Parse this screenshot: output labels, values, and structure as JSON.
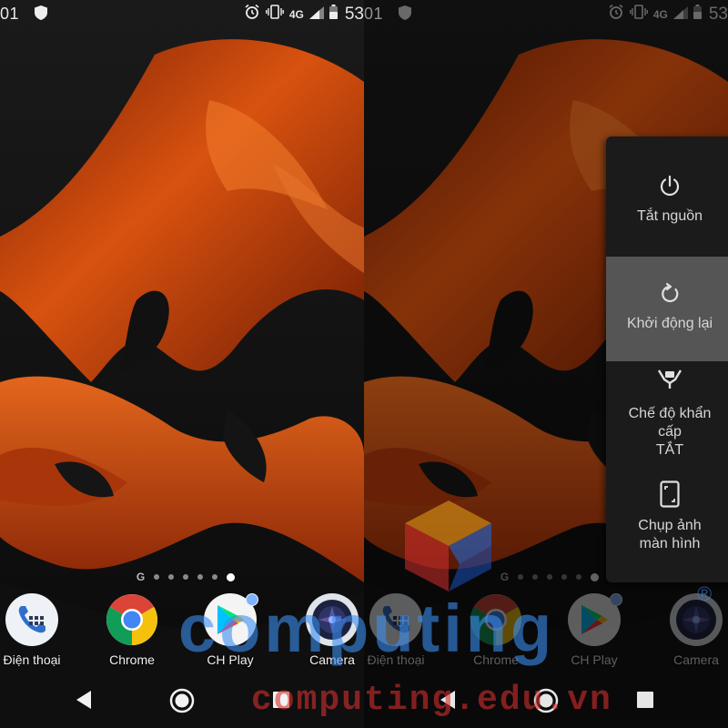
{
  "status_bar": {
    "time": "01",
    "network": "4G",
    "battery": "53"
  },
  "dock": [
    {
      "label": "Điện thoại"
    },
    {
      "label": "Chrome"
    },
    {
      "label": "CH Play"
    },
    {
      "label": "Camera"
    }
  ],
  "page_indicator": {
    "launcher_letter": "G",
    "pages": 6,
    "active_page": 6
  },
  "power_menu": {
    "items": [
      {
        "label": "Tắt nguồn"
      },
      {
        "label": "Khởi động lại",
        "highlighted": true
      },
      {
        "label_line1": "Chế độ khẩn",
        "label_line2": "cấp",
        "label_line3": "TẮT"
      },
      {
        "label_line1": "Chụp ảnh",
        "label_line2": "màn hình"
      }
    ]
  },
  "watermark": {
    "logo_text": "computing",
    "registered": "®",
    "site": "computing.edu.vn"
  },
  "colors": {
    "wallpaper_orange": "#c2410c",
    "power_menu_bg": "#1b1b1b",
    "highlight": "#555555"
  }
}
